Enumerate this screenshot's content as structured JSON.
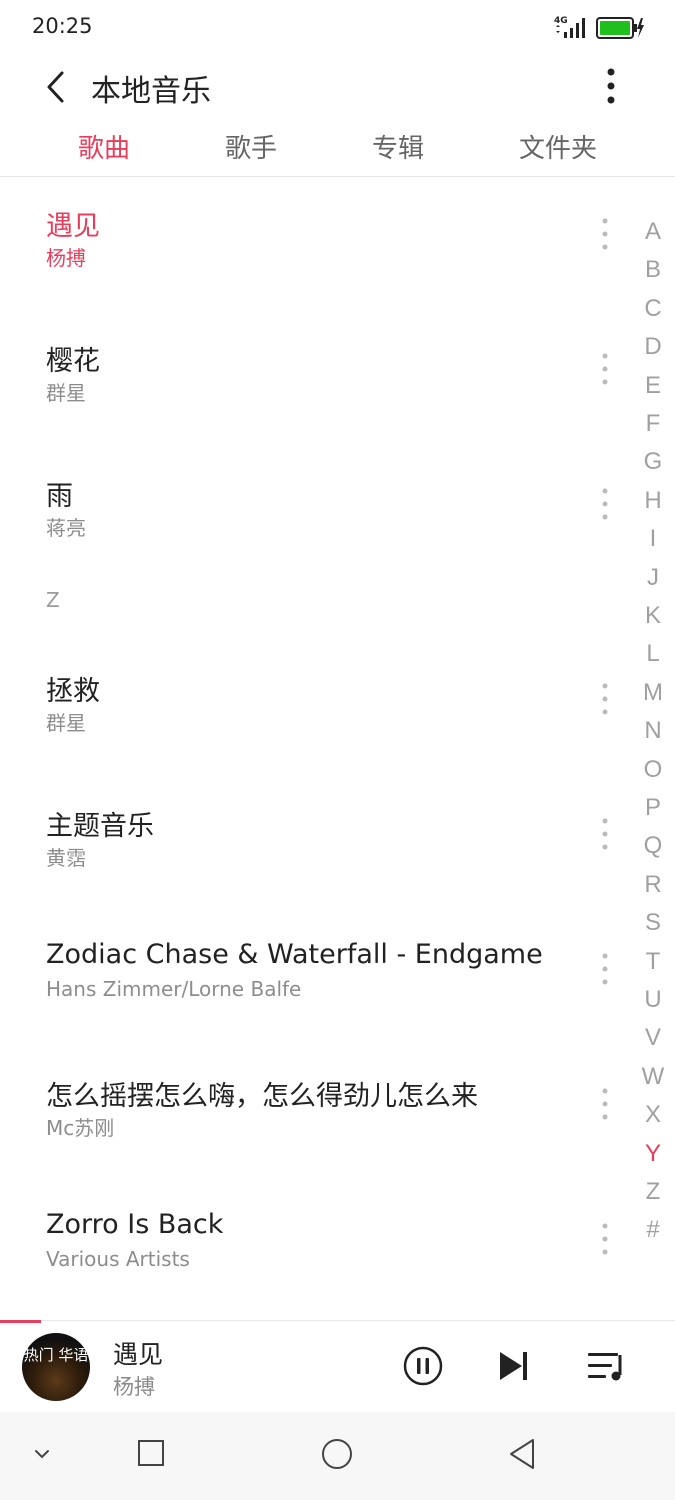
{
  "status_bar": {
    "time": "20:25",
    "network": "4G",
    "icons": [
      "signal-icon",
      "battery-charging-icon"
    ]
  },
  "header": {
    "title": "本地音乐",
    "back_icon": "back-icon",
    "more_icon": "more-vertical-icon"
  },
  "tabs": [
    {
      "label": "歌曲",
      "active": true
    },
    {
      "label": "歌手",
      "active": false
    },
    {
      "label": "专辑",
      "active": false
    },
    {
      "label": "文件夹",
      "active": false
    }
  ],
  "songs": [
    {
      "title": "遇见",
      "artist": "杨搏",
      "playing": true
    },
    {
      "title": "樱花",
      "artist": "群星"
    },
    {
      "title": "雨",
      "artist": "蒋亮"
    },
    {
      "title": "拯救",
      "artist": "群星"
    },
    {
      "title": "主题音乐",
      "artist": "黄霑"
    },
    {
      "title": "Zodiac Chase & Waterfall - Endgame",
      "artist": "Hans Zimmer/Lorne Balfe"
    },
    {
      "title": "怎么摇摆怎么嗨，怎么得劲儿怎么来",
      "artist": "Mc苏刚"
    },
    {
      "title": "Zorro Is Back",
      "artist": "Various Artists"
    }
  ],
  "section_letter": "Z",
  "alphabet": [
    "A",
    "B",
    "C",
    "D",
    "E",
    "F",
    "G",
    "H",
    "I",
    "J",
    "K",
    "L",
    "M",
    "N",
    "O",
    "P",
    "Q",
    "R",
    "S",
    "T",
    "U",
    "V",
    "W",
    "X",
    "Y",
    "Z",
    "#"
  ],
  "alphabet_active": "Y",
  "player": {
    "title": "遇见",
    "artist": "杨搏",
    "cover_text": "热门 华语",
    "progress_fraction": 0.06,
    "icons": [
      "pause-icon",
      "next-icon",
      "playlist-icon"
    ]
  },
  "nav": {
    "icons": [
      "nav-collapse-icon",
      "recents-icon",
      "home-icon",
      "back-icon"
    ]
  },
  "colors": {
    "accent": "#e83e5d",
    "battery": "#1ec01e"
  }
}
